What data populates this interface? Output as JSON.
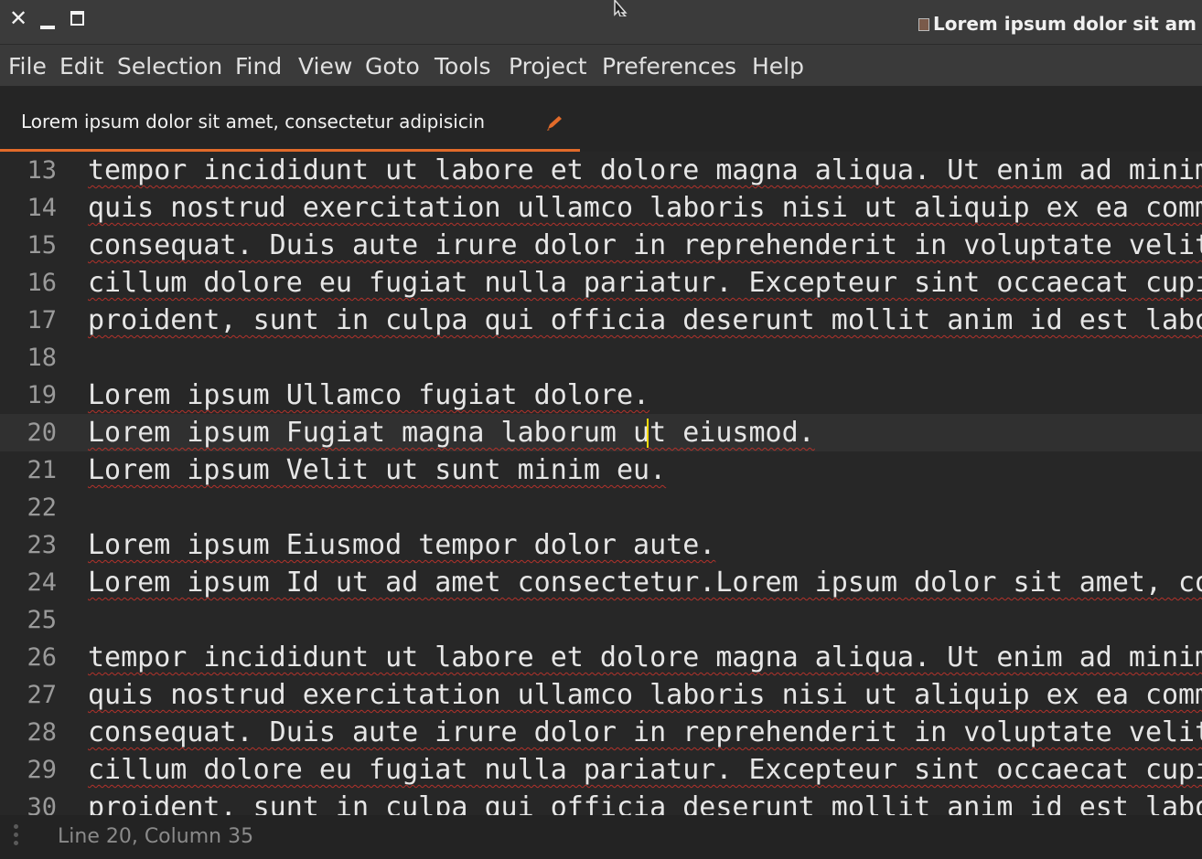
{
  "window": {
    "title": "Lorem ipsum dolor sit am",
    "controls": [
      "close-icon",
      "minimize-icon",
      "maximize-icon"
    ]
  },
  "menu": {
    "items": [
      "File",
      "Edit",
      "Selection",
      "Find",
      "View",
      "Goto",
      "Tools",
      "Project",
      "Preferences",
      "Help"
    ]
  },
  "tab": {
    "label": "Lorem ipsum dolor sit amet, consectetur adipisicin",
    "accent_color": "#e26b2a",
    "icon": "pencil-icon"
  },
  "editor": {
    "lines": [
      {
        "number": "13",
        "text": "tempor incididunt ut labore et dolore magna aliqua. Ut enim ad minim"
      },
      {
        "number": "14",
        "text": "quis nostrud exercitation ullamco laboris nisi ut aliquip ex ea comm"
      },
      {
        "number": "15",
        "text": "consequat. Duis aute irure dolor in reprehenderit in voluptate velit"
      },
      {
        "number": "16",
        "text": "cillum dolore eu fugiat nulla pariatur. Excepteur sint occaecat cupi"
      },
      {
        "number": "17",
        "text": "proident, sunt in culpa qui officia deserunt mollit anim id est labo"
      },
      {
        "number": "18",
        "text": ""
      },
      {
        "number": "19",
        "text": "Lorem ipsum Ullamco fugiat dolore."
      },
      {
        "number": "20",
        "text": "Lorem ipsum Fugiat magna laborum ut eiusmod."
      },
      {
        "number": "21",
        "text": "Lorem ipsum Velit ut sunt minim eu."
      },
      {
        "number": "22",
        "text": ""
      },
      {
        "number": "23",
        "text": "Lorem ipsum Eiusmod tempor dolor aute."
      },
      {
        "number": "24",
        "text": "Lorem ipsum Id ut ad amet consectetur.Lorem ipsum dolor sit amet, co"
      },
      {
        "number": "25",
        "text": ""
      },
      {
        "number": "26",
        "text": "tempor incididunt ut labore et dolore magna aliqua. Ut enim ad minim"
      },
      {
        "number": "27",
        "text": "quis nostrud exercitation ullamco laboris nisi ut aliquip ex ea comm"
      },
      {
        "number": "28",
        "text": "consequat. Duis aute irure dolor in reprehenderit in voluptate velit"
      },
      {
        "number": "29",
        "text": "cillum dolore eu fugiat nulla pariatur. Excepteur sint occaecat cupi"
      },
      {
        "number": "30",
        "text": "proident, sunt in culpa qui officia deserunt mollit anim id est labo"
      }
    ],
    "current_line": "20",
    "caret_color": "#f5d90a",
    "spellcheck_color": "#b3322b"
  },
  "status": {
    "text": "Line 20, Column 35"
  }
}
